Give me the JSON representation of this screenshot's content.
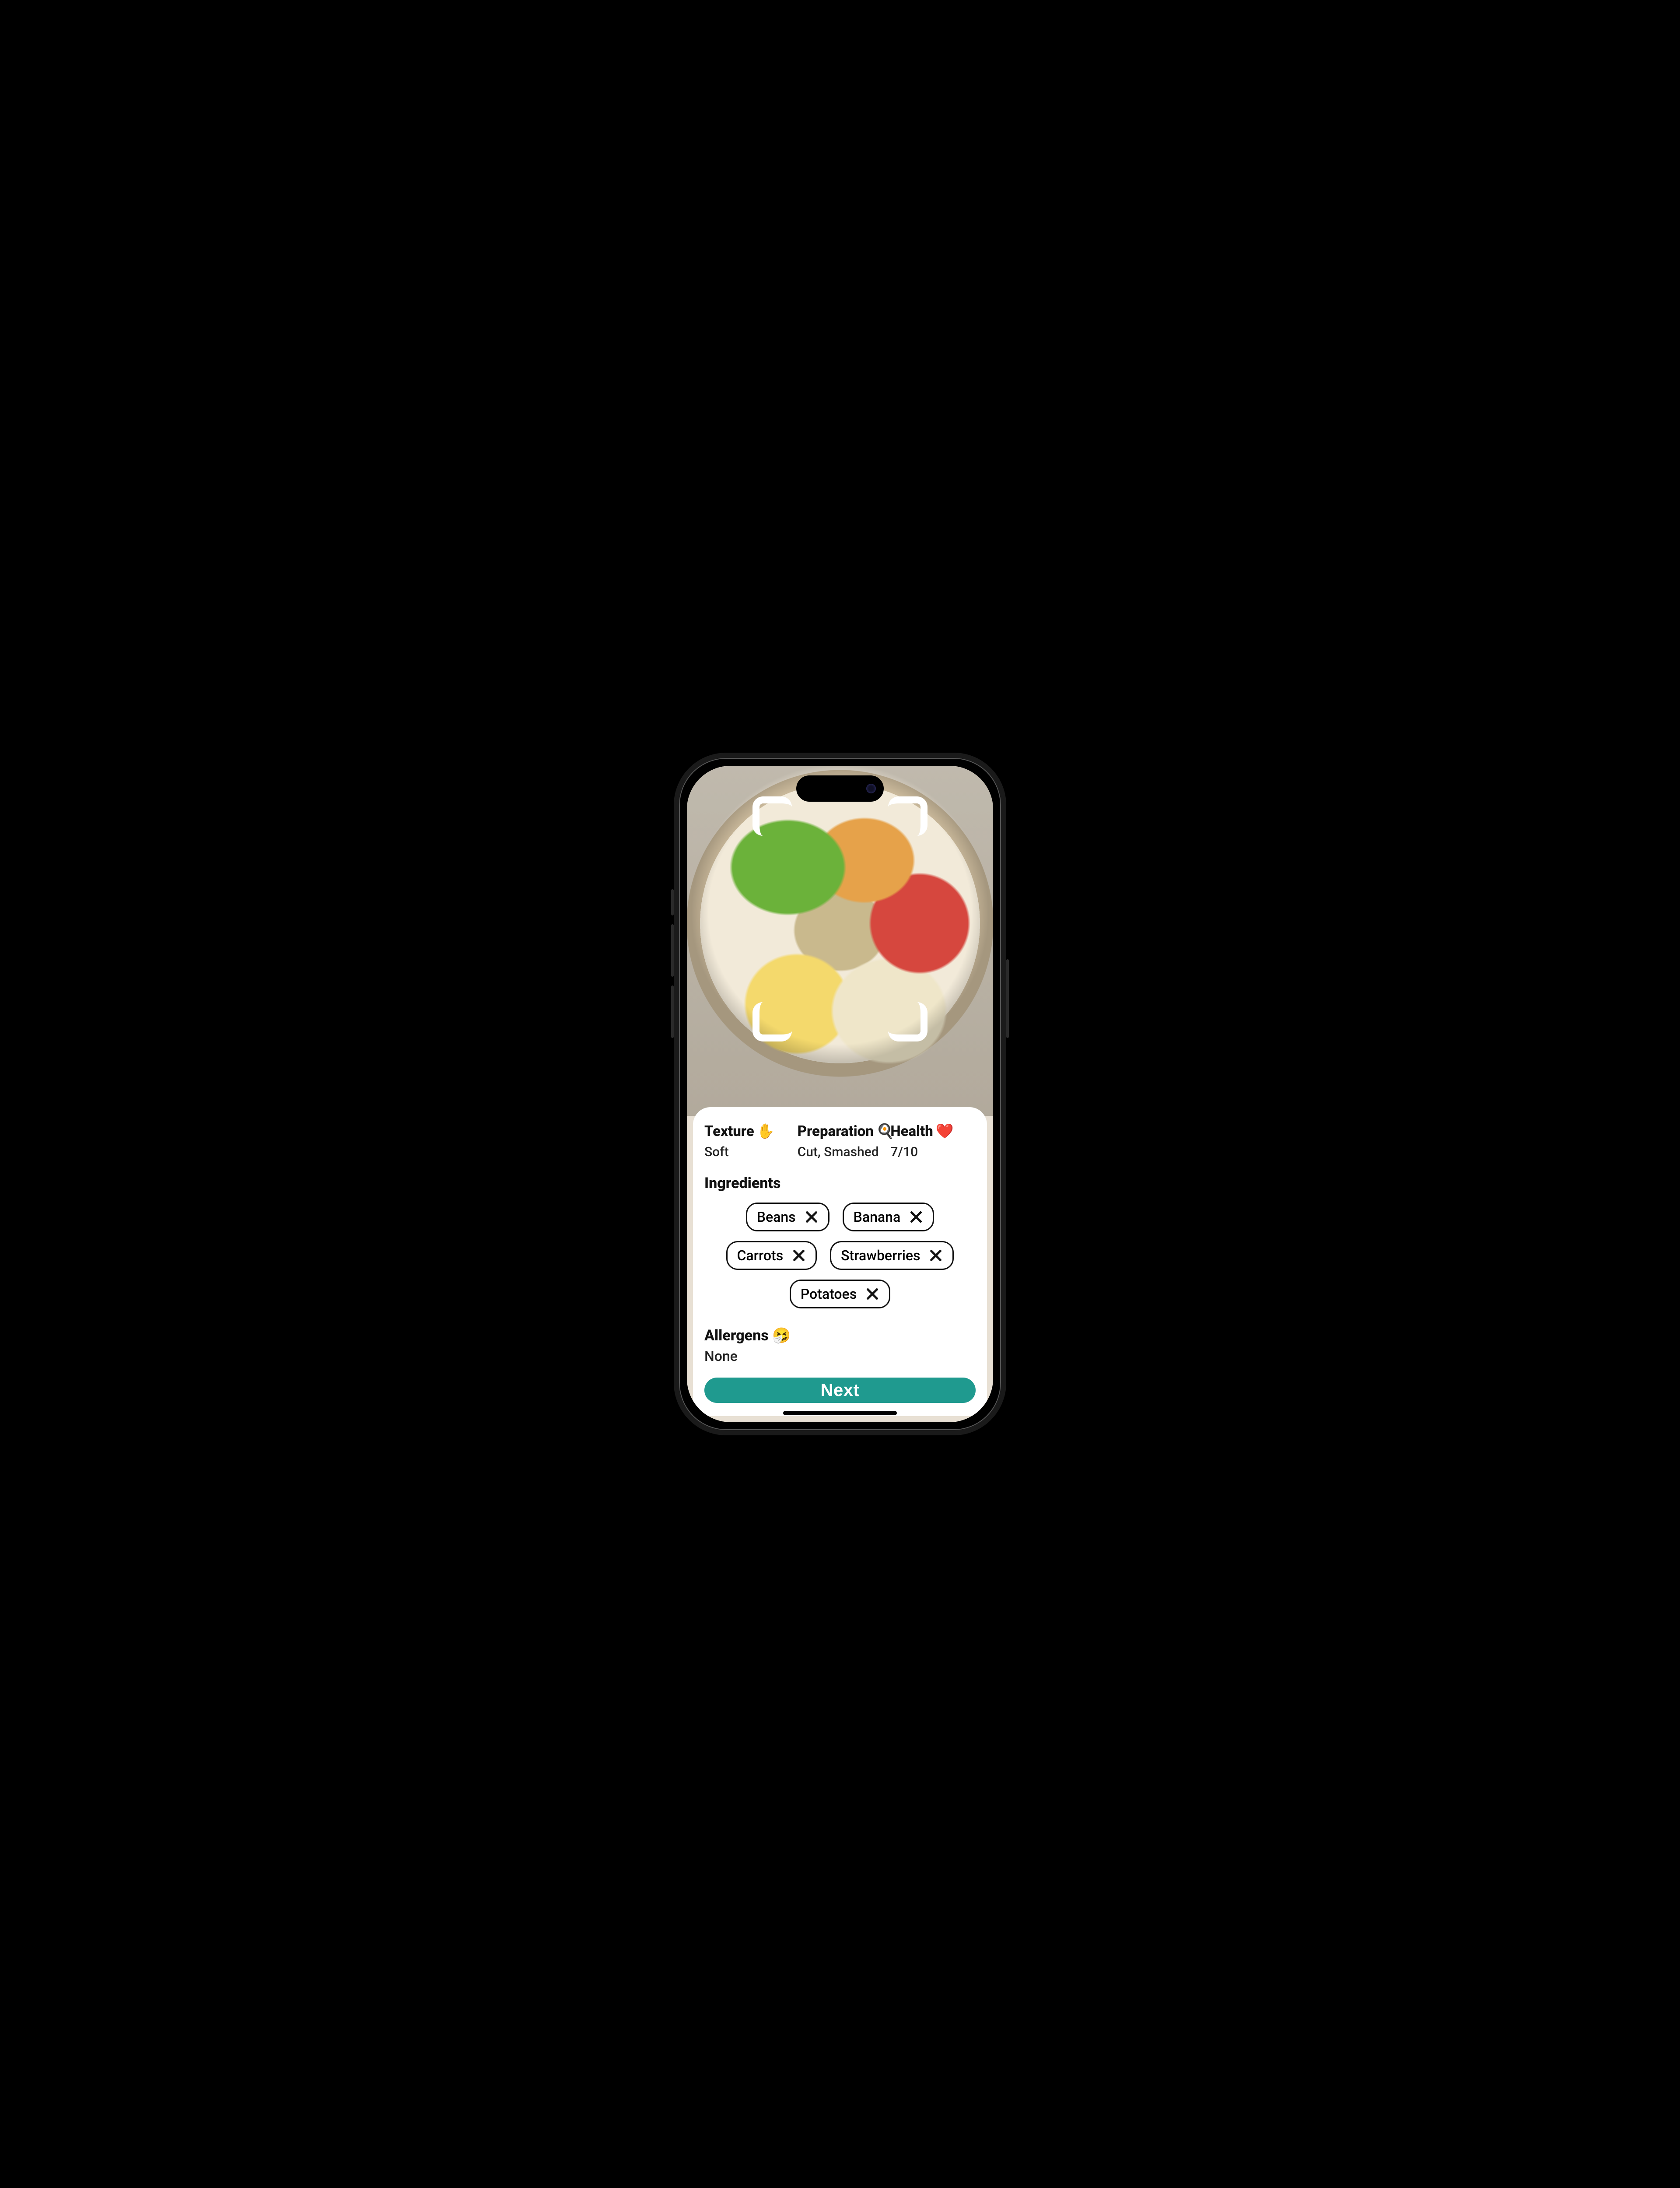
{
  "image_description": "A beige plate on a light surface, top‑down view. Sections of green peas, orange flower‑cut carrot slices, red strawberries, pale banana slices, yellow banana/plantain chunks, and a centre swirl of mashed potato/purée. White scan‑frame corner brackets overlay the plate.",
  "stats": {
    "texture": {
      "label": "Texture",
      "emoji": "✋",
      "value": "Soft"
    },
    "preparation": {
      "label": "Preparation",
      "emoji": "🍳",
      "value": "Cut, Smashed"
    },
    "health": {
      "label": "Health",
      "emoji": "❤️",
      "value": "7/10"
    }
  },
  "ingredients": {
    "title": "Ingredients",
    "items": [
      "Beans",
      "Banana",
      "Carrots",
      "Strawberries",
      "Potatoes"
    ]
  },
  "allergens": {
    "title": "Allergens",
    "emoji": "🤧",
    "value": "None"
  },
  "actions": {
    "next": "Next"
  }
}
